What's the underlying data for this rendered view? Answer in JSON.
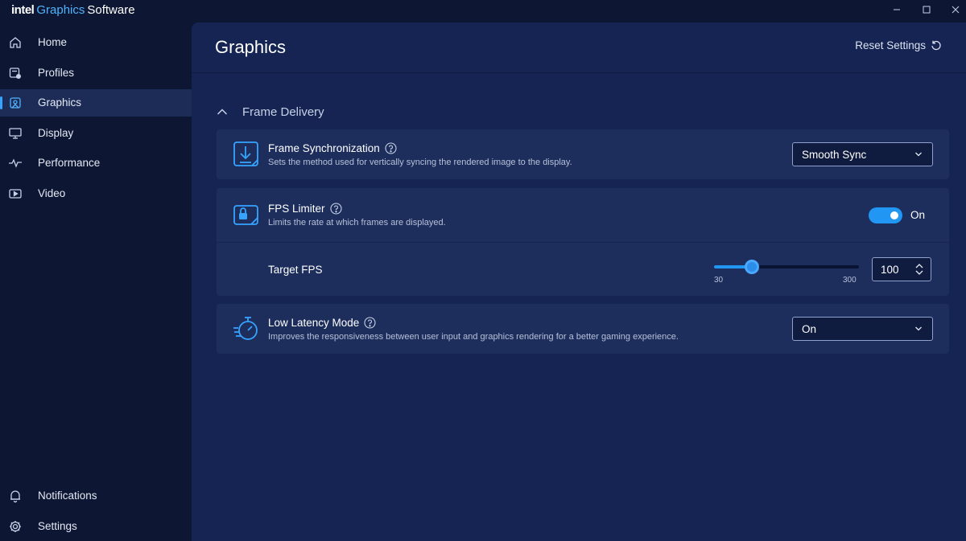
{
  "app": {
    "brand_intel": "intel",
    "brand_graphics": "Graphics",
    "brand_software": "Software"
  },
  "colors": {
    "accent": "#2196f3",
    "sidebar_bg": "#0d1632",
    "main_bg": "#152452",
    "card_bg": "#1d2e5c"
  },
  "sidebar": {
    "items": [
      {
        "label": "Home",
        "icon": "home-icon",
        "active": false
      },
      {
        "label": "Profiles",
        "icon": "profiles-icon",
        "active": false
      },
      {
        "label": "Graphics",
        "icon": "graphics-icon",
        "active": true
      },
      {
        "label": "Display",
        "icon": "display-icon",
        "active": false
      },
      {
        "label": "Performance",
        "icon": "performance-icon",
        "active": false
      },
      {
        "label": "Video",
        "icon": "video-icon",
        "active": false
      }
    ],
    "bottom": [
      {
        "label": "Notifications",
        "icon": "bell-icon"
      },
      {
        "label": "Settings",
        "icon": "gear-icon"
      }
    ]
  },
  "main": {
    "title": "Graphics",
    "reset_label": "Reset Settings",
    "section": {
      "title": "Frame Delivery",
      "expanded": true
    },
    "frame_sync": {
      "title": "Frame Synchronization",
      "description": "Sets the method used for vertically syncing the rendered image to the display.",
      "value": "Smooth Sync"
    },
    "fps_limiter": {
      "title": "FPS Limiter",
      "description": "Limits the rate at which frames are displayed.",
      "state_label": "On",
      "enabled": true
    },
    "target_fps": {
      "label": "Target FPS",
      "min": "30",
      "max": "300",
      "value": "100",
      "slider_fraction": 0.26
    },
    "low_latency": {
      "title": "Low Latency Mode",
      "description": "Improves the responsiveness between user input and graphics rendering for a better gaming experience.",
      "value": "On"
    }
  }
}
